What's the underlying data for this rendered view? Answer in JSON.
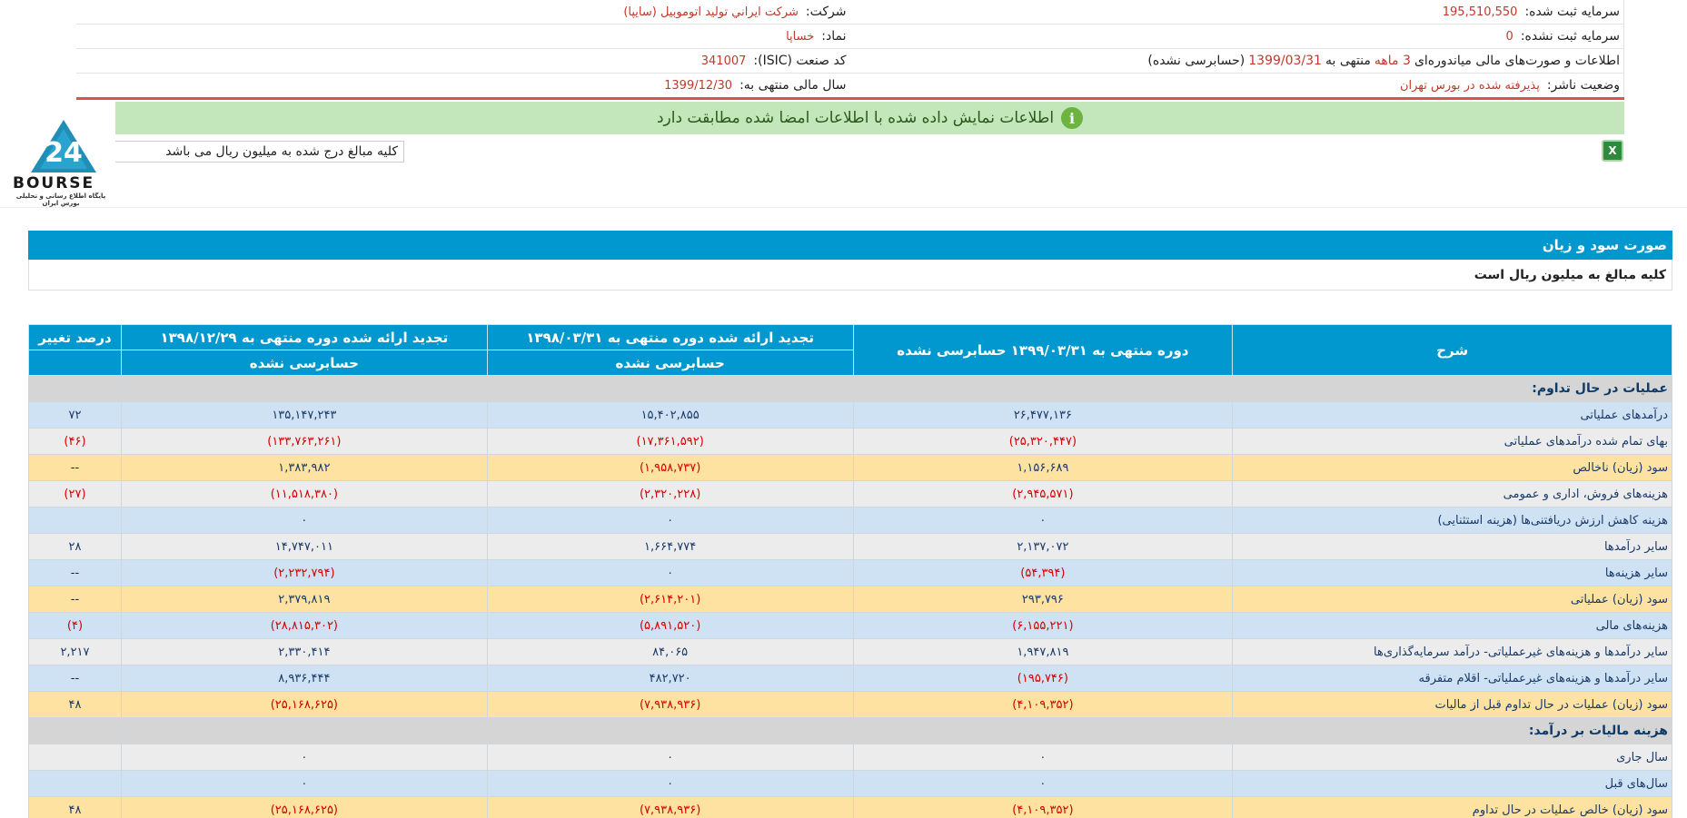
{
  "info": {
    "company_label": "شرکت:",
    "company_value": "شرکت ايراني توليد اتوموبيل (سايپا)",
    "registered_capital_label": "سرمایه ثبت شده:",
    "registered_capital_value": "195,510,550",
    "symbol_label": "نماد:",
    "symbol_value": "خساپا",
    "unregistered_capital_label": "سرمایه ثبت نشده:",
    "unregistered_capital_value": "0",
    "isic_label": "کد صنعت (ISIC):",
    "isic_value": "341007",
    "report_prefix": "اطلاعات و صورت‌های مالی میاندوره‌ای",
    "report_period": "3 ماهه",
    "report_mid": "منتهی به",
    "report_date": "1399/03/31",
    "report_suffix": "(حسابرسی نشده)",
    "fiscal_label": "سال مالی منتهی به:",
    "fiscal_value": "1399/12/30",
    "publisher_status_label": "وضعیت ناشر:",
    "publisher_status_value": "پذیرفته شده در بورس تهران"
  },
  "notice": {
    "text": "اطلاعات نمایش داده شده با اطلاعات امضا شده مطابقت دارد",
    "icon": "info-icon",
    "color": "#c3e6bb"
  },
  "unit_note": "کلیه مبالغ درج شده به میلیون ریال می باشد",
  "logo": {
    "word": "BOURSE",
    "sub": "پایگاه اطلاع رسانی و تحلیلی بورس ایران"
  },
  "section": {
    "title": "صورت سود و زیان",
    "subtitle": "کلیه مبالغ به میلیون ریال است",
    "color": "#0098cf"
  },
  "table": {
    "headers": {
      "desc": "شرح",
      "col1": "دوره منتهی به ۱۳۹۹/۰۳/۳۱ حسابرسی نشده",
      "col2": "تجدید ارائه شده دوره منتهی به ۱۳۹۸/۰۳/۳۱",
      "col3": "تجدید ارائه شده دوره منتهی به ۱۳۹۸/۱۲/۲۹",
      "col4": "درصد تغییر",
      "col2_sub": "حسابرسی نشده",
      "col3_sub": "حسابرسی نشده"
    },
    "rows": [
      {
        "type": "sect",
        "desc": "عملیات در حال تداوم:",
        "c1": "",
        "c2": "",
        "c3": "",
        "c4": ""
      },
      {
        "type": "blue",
        "desc": "درآمدهای عملیاتی",
        "c1": "۲۶,۴۷۷,۱۳۶",
        "c2": "۱۵,۴۰۲,۸۵۵",
        "c3": "۱۳۵,۱۴۷,۲۴۳",
        "c4": "۷۲"
      },
      {
        "type": "gray",
        "desc": "بهای تمام شده درآمدهای عملیاتی",
        "c1": "(۲۵,۳۲۰,۴۴۷)",
        "c2": "(۱۷,۳۶۱,۵۹۲)",
        "c3": "(۱۳۳,۷۶۳,۲۶۱)",
        "c4": "(۴۶)"
      },
      {
        "type": "yellow",
        "desc": "سود (زیان) ناخالص",
        "c1": "۱,۱۵۶,۶۸۹",
        "c2": "(۱,۹۵۸,۷۳۷)",
        "c3": "۱,۳۸۳,۹۸۲",
        "c4": "--"
      },
      {
        "type": "gray",
        "desc": "هزینه‌های فروش، اداری و عمومی",
        "c1": "(۲,۹۴۵,۵۷۱)",
        "c2": "(۲,۳۲۰,۲۲۸)",
        "c3": "(۱۱,۵۱۸,۳۸۰)",
        "c4": "(۲۷)"
      },
      {
        "type": "blue",
        "desc": "هزینه کاهش ارزش دریافتنی‌ها (هزینه استثنایی)",
        "c1": "۰",
        "c2": "۰",
        "c3": "۰",
        "c4": ""
      },
      {
        "type": "gray",
        "desc": "سایر درآمدها",
        "c1": "۲,۱۳۷,۰۷۲",
        "c2": "۱,۶۶۴,۷۷۴",
        "c3": "۱۴,۷۴۷,۰۱۱",
        "c4": "۲۸"
      },
      {
        "type": "blue",
        "desc": "سایر هزینه‌ها",
        "c1": "(۵۴,۳۹۴)",
        "c2": "۰",
        "c3": "(۲,۲۳۲,۷۹۴)",
        "c4": "--"
      },
      {
        "type": "yellow",
        "desc": "سود (زیان) عملیاتی",
        "c1": "۲۹۳,۷۹۶",
        "c2": "(۲,۶۱۴,۲۰۱)",
        "c3": "۲,۳۷۹,۸۱۹",
        "c4": "--"
      },
      {
        "type": "blue",
        "desc": "هزینه‌های مالی",
        "c1": "(۶,۱۵۵,۲۲۱)",
        "c2": "(۵,۸۹۱,۵۲۰)",
        "c3": "(۲۸,۸۱۵,۳۰۲)",
        "c4": "(۴)"
      },
      {
        "type": "gray",
        "desc": "سایر درآمدها و هزینه‌های غیرعملیاتی- درآمد سرمایه‌گذاری‌ها",
        "c1": "۱,۹۴۷,۸۱۹",
        "c2": "۸۴,۰۶۵",
        "c3": "۲,۳۳۰,۴۱۴",
        "c4": "۲,۲۱۷"
      },
      {
        "type": "blue",
        "desc": "سایر درآمدها و هزینه‌های غیرعملیاتی- اقلام متفرقه",
        "c1": "(۱۹۵,۷۴۶)",
        "c2": "۴۸۲,۷۲۰",
        "c3": "۸,۹۳۶,۴۴۴",
        "c4": "--"
      },
      {
        "type": "yellow",
        "desc": "سود (زیان) عملیات در حال تداوم قبل از مالیات",
        "c1": "(۴,۱۰۹,۳۵۲)",
        "c2": "(۷,۹۳۸,۹۳۶)",
        "c3": "(۲۵,۱۶۸,۶۲۵)",
        "c4": "۴۸"
      },
      {
        "type": "sect",
        "desc": "هزینه مالیات بر درآمد:",
        "c1": "",
        "c2": "",
        "c3": "",
        "c4": ""
      },
      {
        "type": "gray",
        "desc": "سال جاری",
        "c1": "۰",
        "c2": "۰",
        "c3": "۰",
        "c4": ""
      },
      {
        "type": "blue",
        "desc": "سال‌های قبل",
        "c1": "۰",
        "c2": "۰",
        "c3": "۰",
        "c4": ""
      },
      {
        "type": "yellow",
        "desc": "سود (زیان) خالص عملیات در حال تداوم",
        "c1": "(۴,۱۰۹,۳۵۲)",
        "c2": "(۷,۹۳۸,۹۳۶)",
        "c3": "(۲۵,۱۶۸,۶۲۵)",
        "c4": "۴۸"
      }
    ]
  }
}
